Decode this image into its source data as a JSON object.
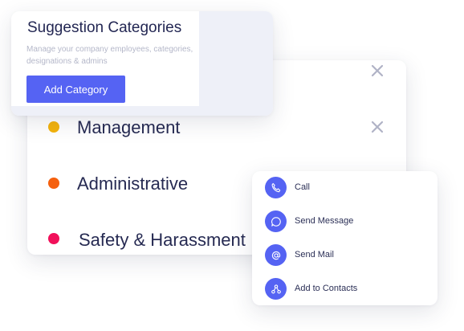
{
  "header": {
    "title": "Suggestion Categories",
    "description": "Manage your company employees, categories, designations & admins",
    "add_button_label": "Add Category"
  },
  "categories": [
    {
      "label": "Management",
      "color": "#f4b30b",
      "removable": true
    },
    {
      "label": "Administrative",
      "color": "#f5600e",
      "removable": false
    },
    {
      "label": "Safety & Harassment",
      "color": "#f1105a",
      "removable": false
    }
  ],
  "close_icon": "close-icon",
  "actions": [
    {
      "label": "Call",
      "icon": "phone-icon"
    },
    {
      "label": "Send Message",
      "icon": "message-bubble-icon"
    },
    {
      "label": "Send Mail",
      "icon": "at-sign-icon"
    },
    {
      "label": "Add to Contacts",
      "icon": "contacts-share-icon"
    }
  ],
  "colors": {
    "accent": "#5563f3",
    "title_text": "#232753",
    "muted_text": "#b4b7c9",
    "close_icon": "#b0b3c6"
  }
}
